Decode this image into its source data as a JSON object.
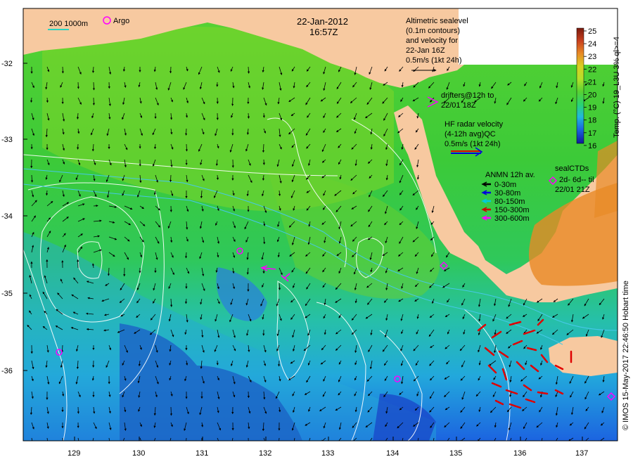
{
  "map": {
    "date": "22-Jan-2012",
    "time": "16:57Z",
    "scale_bar": "200  1000m",
    "argo_label": "Argo",
    "altimetric_lines": [
      "Altimetric sealevel",
      "(0.1m contours)",
      "and velocity for",
      "22-Jan 16Z",
      "0.5m/s (1kt 24h)"
    ],
    "drifters_lines": [
      "drifters@12h to",
      "22/01 18Z"
    ],
    "hf_radar_lines": [
      "HF radar velocity",
      "(4-12h avg)QC",
      "0.5m/s (1kt 24h)"
    ],
    "anmn": {
      "title": "ANMN 12h av.",
      "entries": [
        {
          "label": "0-30m",
          "color": "#000000"
        },
        {
          "label": "30-80m",
          "color": "#0000dd"
        },
        {
          "label": "80-150m",
          "color": "#00ccdd"
        },
        {
          "label": "150-300m",
          "color": "#cc0000"
        },
        {
          "label": "300-600m",
          "color": "#ff00ff"
        }
      ]
    },
    "seal_lines": [
      "sealCTDs",
      "2d- 6d-- til",
      "22/01 21Z"
    ],
    "credit": "© IMOS 15-May-2017 22:46:50 Hobart time",
    "colorbar": {
      "label": "Temp. (°C) 19_L3U 3% ql>=4",
      "ticks": [
        "25",
        "24",
        "23",
        "22",
        "21",
        "20",
        "19",
        "18",
        "17",
        "16"
      ],
      "colors": [
        "#7a1a0e",
        "#c8401e",
        "#e88a26",
        "#d9cf22",
        "#b6e02a",
        "#58d232",
        "#2ad470",
        "#22b8dc",
        "#1c64e0",
        "#101a9a"
      ]
    },
    "lat_ticks": [
      "-32",
      "-33",
      "-34",
      "-35",
      "-36"
    ],
    "lon_ticks": [
      "129",
      "130",
      "131",
      "132",
      "133",
      "134",
      "135",
      "136",
      "137"
    ],
    "colors": {
      "land": "#f7c9a0",
      "sea_green": "#3fc83a",
      "contour": "#ffffff",
      "magenta": "#ff00ff",
      "radar_red": "#e00000"
    }
  }
}
